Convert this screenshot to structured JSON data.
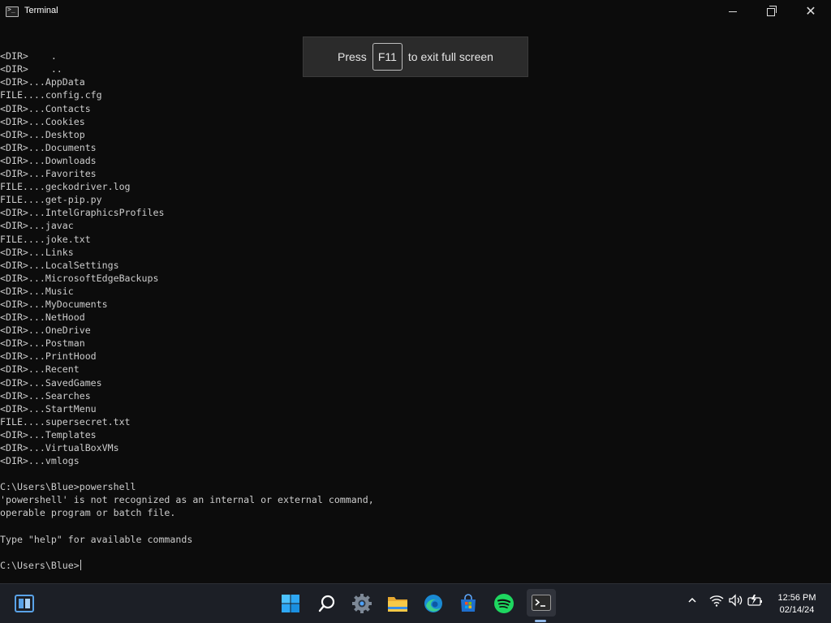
{
  "window": {
    "title": "Terminal"
  },
  "terminal": {
    "lines": [
      "<DIR>    .",
      "<DIR>    ..",
      "<DIR>...AppData",
      "FILE....config.cfg",
      "<DIR>...Contacts",
      "<DIR>...Cookies",
      "<DIR>...Desktop",
      "<DIR>...Documents",
      "<DIR>...Downloads",
      "<DIR>...Favorites",
      "FILE....geckodriver.log",
      "FILE....get-pip.py",
      "<DIR>...IntelGraphicsProfiles",
      "<DIR>...javac",
      "FILE....joke.txt",
      "<DIR>...Links",
      "<DIR>...LocalSettings",
      "<DIR>...MicrosoftEdgeBackups",
      "<DIR>...Music",
      "<DIR>...MyDocuments",
      "<DIR>...NetHood",
      "<DIR>...OneDrive",
      "<DIR>...Postman",
      "<DIR>...PrintHood",
      "<DIR>...Recent",
      "<DIR>...SavedGames",
      "<DIR>...Searches",
      "<DIR>...StartMenu",
      "FILE....supersecret.txt",
      "<DIR>...Templates",
      "<DIR>...VirtualBoxVMs",
      "<DIR>...vmlogs",
      "",
      "C:\\Users\\Blue>powershell",
      "'powershell' is not recognized as an internal or external command,",
      "operable program or batch file.",
      "",
      "Type \"help\" for available commands",
      ""
    ],
    "prompt": "C:\\Users\\Blue>"
  },
  "fullscreen_toast": {
    "before": "Press",
    "key": "F11",
    "after": "to exit full screen"
  },
  "taskbar": {
    "time": "12:56 PM",
    "date": "02/14/24",
    "icons": [
      "task-view-icon",
      "windows-start-icon",
      "search-icon",
      "settings-icon",
      "file-explorer-icon",
      "edge-icon",
      "microsoft-store-icon",
      "spotify-icon",
      "terminal-icon"
    ]
  },
  "colors": {
    "terminal_bg": "#0c0c0c",
    "terminal_fg": "#cccccc",
    "taskbar_bg": "#1c1f26",
    "accent": "#8fb6e6"
  }
}
